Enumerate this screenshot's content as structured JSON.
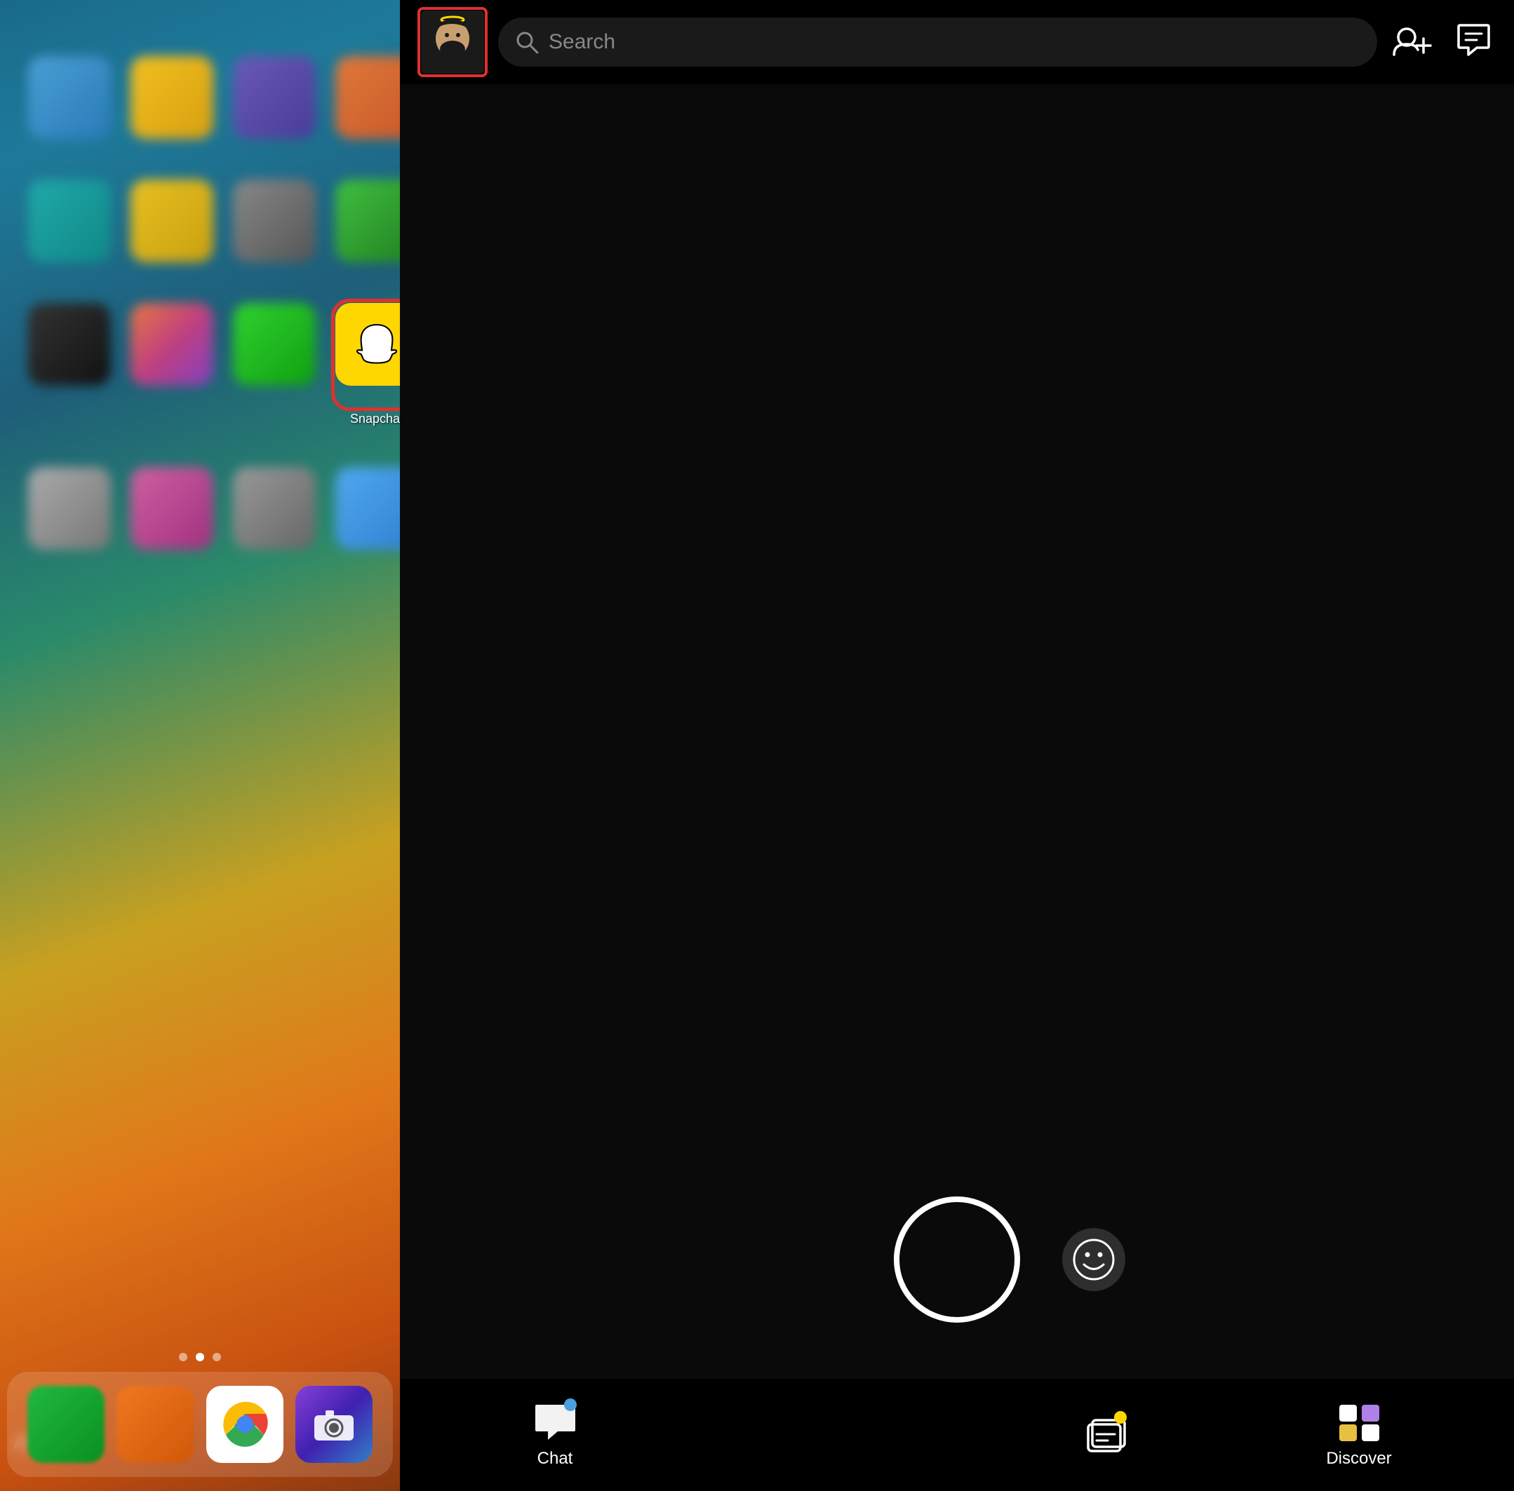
{
  "left": {
    "watermark": "APJALO",
    "snapchat_label": "Snapchat",
    "dock_icons": [
      "green_app",
      "orange_app",
      "chrome",
      "camera"
    ],
    "page_dots": [
      false,
      true,
      false
    ],
    "grid_rows": [
      [
        {
          "color": "blue",
          "blurred": true
        },
        {
          "color": "yellow",
          "blurred": true
        },
        {
          "color": "purple_blue",
          "blurred": true
        },
        {
          "color": "orange",
          "blurred": true
        }
      ],
      [
        {
          "color": "teal",
          "blurred": true
        },
        {
          "color": "yellow2",
          "blurred": true
        },
        {
          "color": "gray",
          "blurred": true
        },
        {
          "color": "green_pixel",
          "blurred": true
        }
      ],
      [
        {
          "color": "dark",
          "blurred": true
        },
        {
          "color": "colorful",
          "blurred": true
        },
        {
          "color": "green2",
          "blurred": true
        },
        {
          "color": "snapchat",
          "blurred": false,
          "label": "Snapchat",
          "highlighted": true
        }
      ],
      [
        {
          "color": "gray2",
          "blurred": true
        },
        {
          "color": "pink",
          "blurred": true
        },
        {
          "color": "gray3",
          "blurred": true
        },
        {
          "color": "blue2",
          "blurred": true
        }
      ]
    ]
  },
  "right": {
    "search_placeholder": "Search",
    "top_right_icons": [
      "add_friend",
      "chat_icon"
    ],
    "side_icons": [
      "flash_off",
      "chevron_down"
    ],
    "bottom_nav": [
      {
        "id": "chat",
        "label": "Chat",
        "dot_color": "#4a9fdf",
        "has_dot": true
      },
      {
        "id": "camera",
        "label": "",
        "has_dot": false
      },
      {
        "id": "memories",
        "label": "",
        "dot_color": "#FFD700",
        "has_dot": true
      },
      {
        "id": "discover",
        "label": "Discover",
        "has_dot": false
      }
    ]
  }
}
